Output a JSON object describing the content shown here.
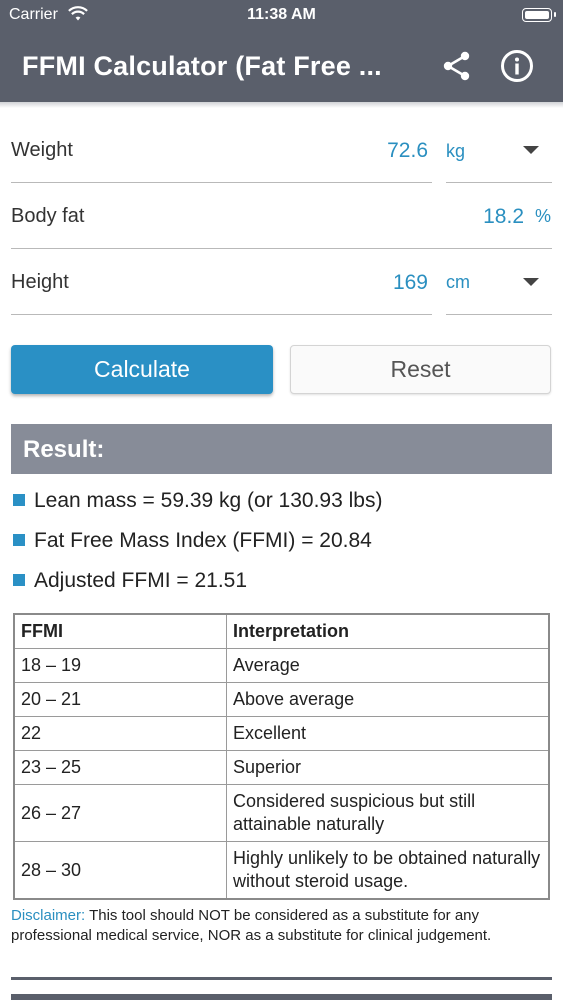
{
  "status_bar": {
    "carrier": "Carrier",
    "time": "11:38 AM"
  },
  "app_bar": {
    "title": "FFMI Calculator (Fat Free ..."
  },
  "inputs": {
    "weight": {
      "label": "Weight",
      "value": "72.6",
      "unit": "kg"
    },
    "body_fat": {
      "label": "Body fat",
      "value": "18.2",
      "unit": "%"
    },
    "height": {
      "label": "Height",
      "value": "169",
      "unit": "cm"
    }
  },
  "buttons": {
    "calculate": "Calculate",
    "reset": "Reset"
  },
  "result": {
    "header": "Result:",
    "lines": [
      "Lean mass = 59.39 kg (or 130.93 lbs)",
      "Fat Free Mass Index (FFMI) = 20.84",
      "Adjusted FFMI = 21.51"
    ]
  },
  "table": {
    "headers": [
      "FFMI",
      "Interpretation"
    ],
    "rows": [
      [
        "18 – 19",
        "Average"
      ],
      [
        "20 – 21",
        "Above average"
      ],
      [
        "22",
        "Excellent"
      ],
      [
        "23 – 25",
        "Superior"
      ],
      [
        "26 – 27",
        "Considered suspicious but still attainable naturally"
      ],
      [
        "28 – 30",
        "Highly unlikely to be obtained naturally without steroid usage."
      ]
    ]
  },
  "disclaimer": {
    "label": "Disclaimer:",
    "text": " This tool should NOT be considered as a substitute for any professional medical service, NOR as a substitute for clinical judgement."
  },
  "colors": {
    "app_bar": "#5a5f6b",
    "accent": "#2a90c5",
    "result_bar": "#878c98"
  },
  "icons": {
    "share": "share-icon",
    "info": "info-icon",
    "wifi": "wifi-icon",
    "battery": "battery-icon",
    "dropdown": "dropdown-caret-icon"
  }
}
